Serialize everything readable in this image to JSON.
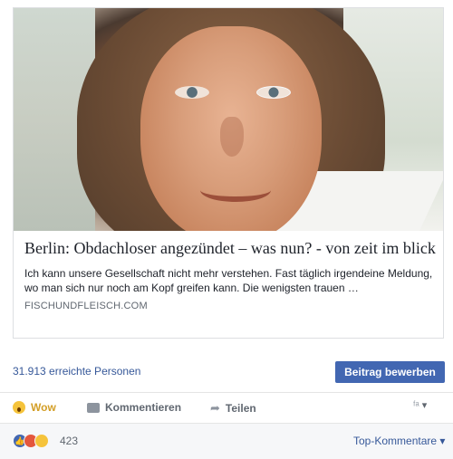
{
  "post": {
    "title": "Berlin: Obdachloser angezündet – was nun? - von zeit im blick",
    "description": "Ich kann unsere Gesellschaft nicht mehr verstehen. Fast täglich irgendeine Meldung, wo man sich nur noch am Kopf greifen kann. Die wenigsten trauen …",
    "domain": "FISCHUNDFLEISCH.COM"
  },
  "stats": {
    "reach": "31.913 erreichte Personen",
    "promote_label": "Beitrag bewerben"
  },
  "actions": {
    "wow": "Wow",
    "comment": "Kommentieren",
    "share": "Teilen",
    "audience_icon": "friends-icon ▾"
  },
  "reactions": {
    "count": "423",
    "sort_label": "Top-Kommentare ▾"
  },
  "colors": {
    "accent": "#4267b2",
    "link": "#365899",
    "wow": "#d39e26"
  }
}
